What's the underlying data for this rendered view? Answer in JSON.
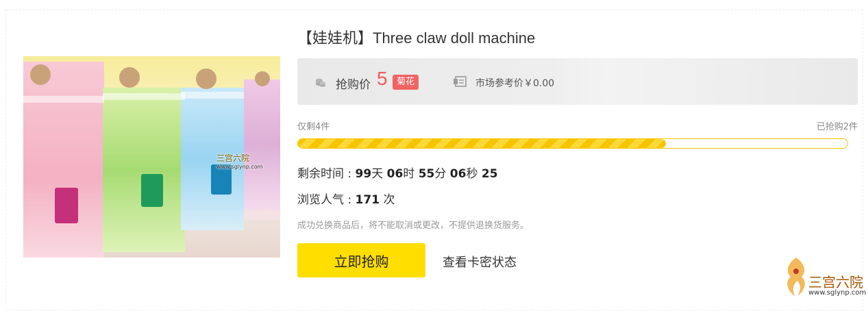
{
  "product": {
    "title": "【娃娃机】Three claw doll machine",
    "image_watermark": {
      "text": "三宫六院",
      "url": "www.sglynp.com"
    }
  },
  "price": {
    "label": "抢购价",
    "value": "5",
    "unit": "菊花",
    "market_label": "市场参考价￥0.00",
    "accent_color": "#f05a5a"
  },
  "stock": {
    "remaining": "仅剩4件",
    "sold": "已抢购2件",
    "progress_fraction": 0.67
  },
  "countdown": {
    "label": "剩余时间 :",
    "days": "99",
    "days_unit": "天",
    "hours": "06",
    "hours_unit": "时",
    "minutes": "55",
    "minutes_unit": "分",
    "seconds": "06",
    "seconds_unit": "秒",
    "tenths": "25"
  },
  "views": {
    "label": "浏览人气 :",
    "count": "171",
    "unit": "次"
  },
  "notice": "成功兑换商品后，将不能取消或更改，不提供退换货服务。",
  "actions": {
    "buy_label": "立即抢购",
    "card_status_label": "查看卡密状态",
    "buy_color": "#ffde00"
  },
  "corner_logo": {
    "text": "三宫六院",
    "url": "www.sglynp.com"
  }
}
